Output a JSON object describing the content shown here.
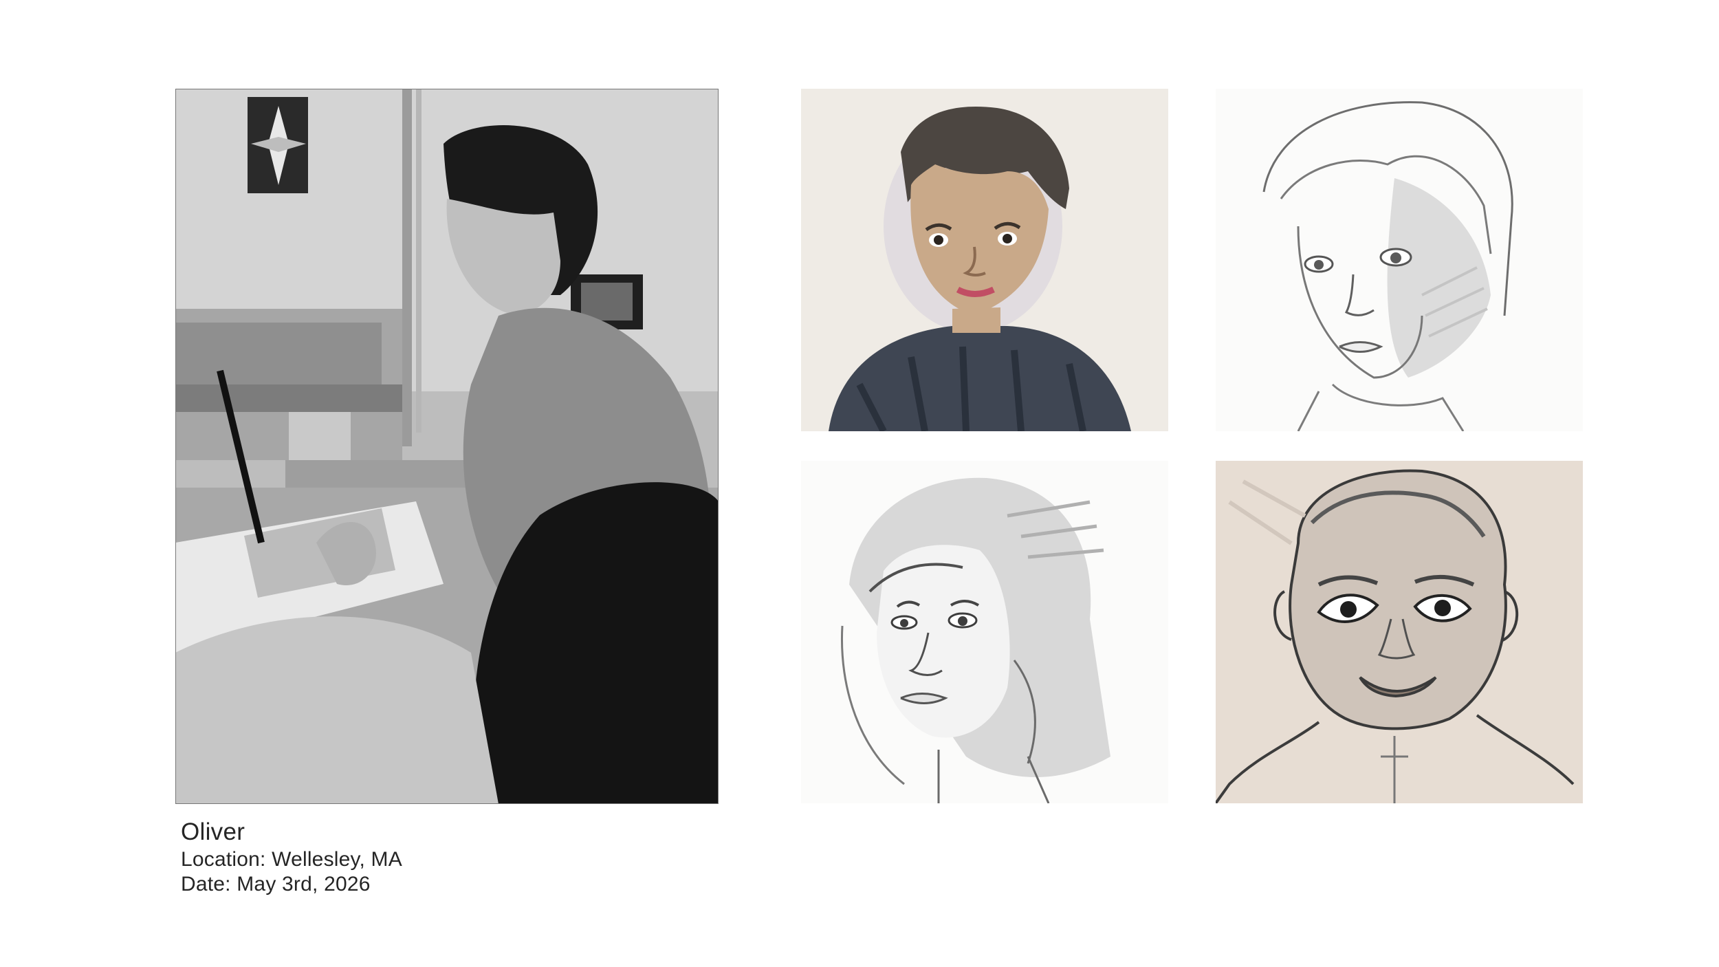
{
  "caption": {
    "name": "Oliver",
    "location": "Location: Wellesley, MA",
    "date": "Date: May 3rd, 2026"
  },
  "images": {
    "photo_icon": "artist-photo-icon",
    "artwork_icons": [
      "child-watercolor-portrait-icon",
      "boy-pencil-sketch-icon",
      "woman-pencil-sketch-icon",
      "baby-pencil-sketch-icon"
    ]
  }
}
